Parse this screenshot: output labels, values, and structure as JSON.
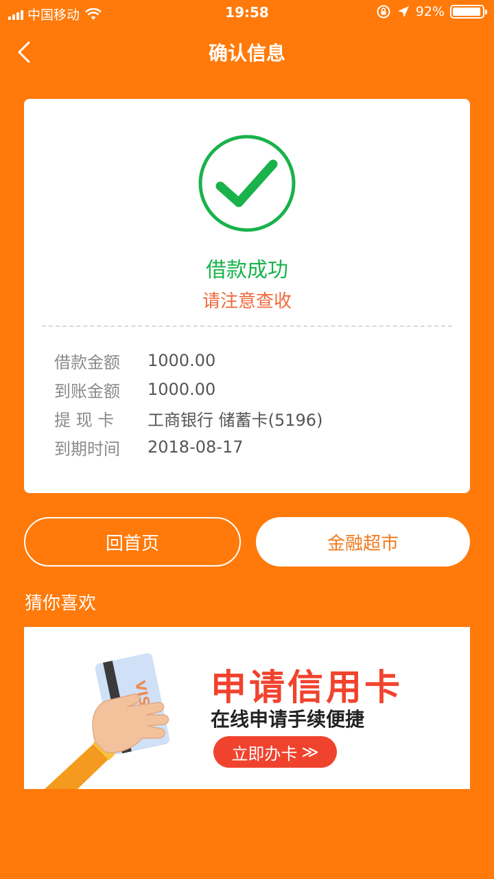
{
  "status_bar": {
    "carrier": "中国移动",
    "time": "19:58",
    "battery": "92%"
  },
  "nav": {
    "title": "确认信息"
  },
  "result": {
    "title": "借款成功",
    "subtitle": "请注意查收"
  },
  "details": [
    {
      "label": "借款金额",
      "value": "1000.00"
    },
    {
      "label": "到账金额",
      "value": "1000.00"
    },
    {
      "label": "提 现 卡",
      "value": "工商银行 储蓄卡(5196)"
    },
    {
      "label": "到期时间",
      "value": "2018-08-17"
    }
  ],
  "buttons": {
    "home": "回首页",
    "market": "金融超市"
  },
  "recommend": {
    "heading": "猜你喜欢"
  },
  "banner": {
    "title": "申请信用卡",
    "subtitle": "在线申请手续便捷",
    "cta": "立即办卡",
    "cta_arrow": "≫",
    "card_brand": "VISA"
  },
  "colors": {
    "background": "#FF7A0A",
    "success": "#19B24B",
    "accent_red": "#F0432E"
  }
}
